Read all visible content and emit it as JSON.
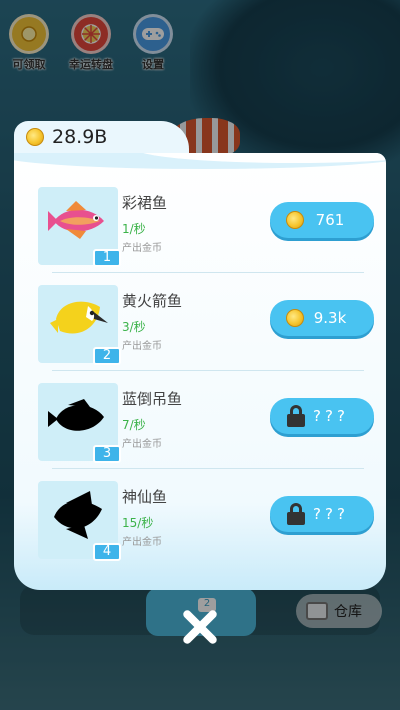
{
  "top_menu": [
    {
      "label": "可领取",
      "icon": "coin-icon"
    },
    {
      "label": "幸运转盘",
      "icon": "wheel-icon"
    },
    {
      "label": "设置",
      "icon": "gamepad-icon"
    }
  ],
  "balance": {
    "value": "28.9B",
    "icon": "coin-icon"
  },
  "fish_list": [
    {
      "name": "彩裙鱼",
      "rate": "1/秒",
      "desc": "产出金币",
      "level": "1",
      "price": "761",
      "locked": false,
      "color": "#e04a8a"
    },
    {
      "name": "黄火箭鱼",
      "rate": "3/秒",
      "desc": "产出金币",
      "level": "2",
      "price": "9.3k",
      "locked": false,
      "color": "#f4d21c"
    },
    {
      "name": "蓝倒吊鱼",
      "rate": "7/秒",
      "desc": "产出金币",
      "level": "3",
      "price": "???",
      "locked": true,
      "color": "#000000"
    },
    {
      "name": "神仙鱼",
      "rate": "15/秒",
      "desc": "产出金币",
      "level": "4",
      "price": "???",
      "locked": true,
      "color": "#000000"
    }
  ],
  "bottom_bar": {
    "warehouse_label": "仓库",
    "buy_fish_level": "2"
  },
  "colors": {
    "accent": "#49c3f1",
    "rate_green": "#3cb34a",
    "badge_blue": "#3eb4ea"
  }
}
